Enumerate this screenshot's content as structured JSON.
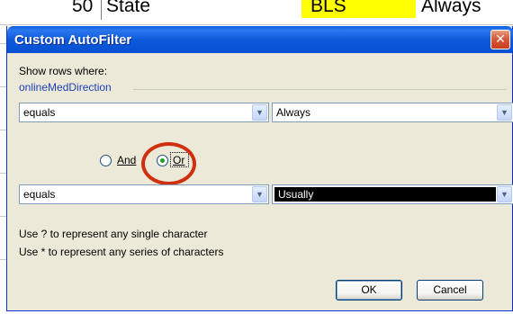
{
  "sheet": {
    "row_number": "50",
    "col_state": "State",
    "col_bls": "BLS",
    "col_always": "Always"
  },
  "dialog": {
    "title": "Custom AutoFilter",
    "close_glyph": "✕",
    "show_rows_label": "Show rows where:",
    "field_name": "onlineMedDirection",
    "condition1": {
      "operator": "equals",
      "value": "Always"
    },
    "logic": {
      "and_label": "And",
      "or_label": "Or",
      "selected": "Or"
    },
    "condition2": {
      "operator": "equals",
      "value": "Usually"
    },
    "hint_single": "Use ? to represent any single character",
    "hint_series": "Use * to represent any series of characters",
    "ok_label": "OK",
    "cancel_label": "Cancel"
  },
  "colors": {
    "titlebar": "#0b58d9",
    "dialog_bg": "#ece9d8",
    "highlight_circle": "#d03010",
    "cell_highlight": "#ffff00"
  },
  "icons": {
    "dropdown": "chevron-down-icon",
    "close": "close-icon"
  }
}
